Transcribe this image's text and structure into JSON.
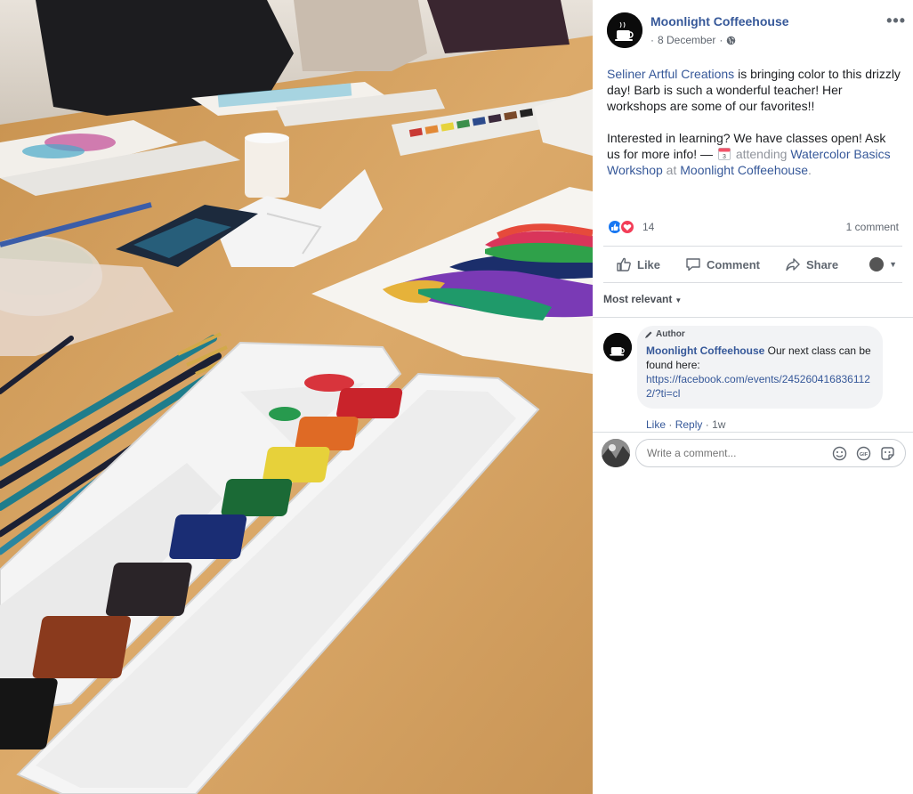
{
  "post": {
    "page_name": "Moonlight Coffeehouse",
    "date": "8 December",
    "more_icon": "more-options-icon",
    "privacy_icon": "globe-icon",
    "text": {
      "tagged_page": "Seliner Artful Creations",
      "line1_rest": " is bringing color to this drizzly day! Barb is such a wonderful teacher! Her workshops are some of our favorites!!",
      "line2_start": "Interested in learning? We have classes open! Ask us for more info! — ",
      "attending": "attending",
      "event_link": "Watercolor Basics Workshop",
      "at": " at ",
      "location_link": "Moonlight Coffeehouse",
      "period": ".",
      "calendar_day": "3"
    }
  },
  "reactions": {
    "count": "14",
    "comment_count": "1 comment",
    "types": [
      "like",
      "love"
    ]
  },
  "actions": {
    "like": "Like",
    "comment": "Comment",
    "share": "Share"
  },
  "sort": {
    "label": "Most relevant"
  },
  "comments": [
    {
      "author_tag": "Author",
      "name": "Moonlight Coffeehouse",
      "text": "Our next class can be found here:",
      "url": "https://facebook.com/events/2452604168361122/?ti=cl",
      "like": "Like",
      "reply": "Reply",
      "age": "1w"
    }
  ],
  "composer": {
    "placeholder": "Write a comment..."
  },
  "colors": {
    "link": "#365899",
    "like_blue": "#1877f2",
    "love_red": "#f33e58",
    "table": "#d9a665"
  }
}
